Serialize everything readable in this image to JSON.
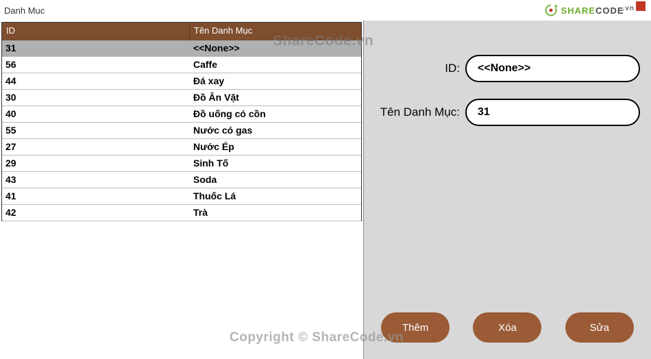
{
  "window": {
    "title": "Danh Muc"
  },
  "logo": {
    "text_share": "SHARE",
    "text_code": "CODE",
    "tld": ".vn"
  },
  "watermarks": {
    "top": "ShareCode.vn",
    "bottom": "Copyright © ShareCode.vn"
  },
  "grid": {
    "headers": {
      "id": "ID",
      "name": "Tên Danh Mục"
    },
    "rows": [
      {
        "id": "31",
        "name": "<<None>>",
        "selected": true
      },
      {
        "id": "56",
        "name": "Caffe"
      },
      {
        "id": "44",
        "name": "Đá xay"
      },
      {
        "id": "30",
        "name": "Đồ Ăn Vặt"
      },
      {
        "id": "40",
        "name": "Đồ uống có cồn"
      },
      {
        "id": "55",
        "name": "Nước có gas"
      },
      {
        "id": "27",
        "name": "Nước Ép"
      },
      {
        "id": "29",
        "name": "Sinh Tố"
      },
      {
        "id": "43",
        "name": "Soda"
      },
      {
        "id": "41",
        "name": "Thuốc Lá"
      },
      {
        "id": "42",
        "name": "Trà"
      }
    ]
  },
  "form": {
    "id_label": "ID:",
    "id_value": "<<None>>",
    "name_label": "Tên Danh Mục:",
    "name_value": "31"
  },
  "buttons": {
    "add": "Thêm",
    "delete": "Xóa",
    "edit": "Sửa"
  }
}
